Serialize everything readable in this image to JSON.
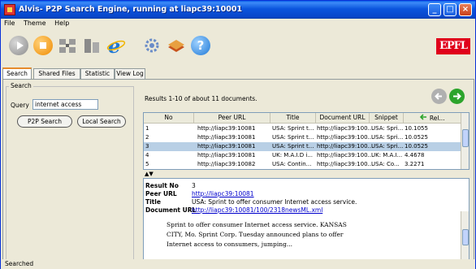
{
  "window": {
    "title": "Alvis- P2P Search Engine, running at liapc39:10001",
    "controls": {
      "minimize": "_",
      "maximize": "□",
      "close": "×"
    }
  },
  "menu": [
    "File",
    "Theme",
    "Help"
  ],
  "toolbar": {
    "icons": [
      "play-icon",
      "stop-icon",
      "network-icon",
      "server-icon",
      "browser-icon",
      "settings-icon",
      "books-icon",
      "help-icon"
    ],
    "help_glyph": "?",
    "logo_text": "EPFL"
  },
  "tabs": [
    "Search",
    "Shared Files",
    "Statistic",
    "View Log"
  ],
  "search": {
    "group_label": "Search",
    "query_label": "Query",
    "query_value": "internet access",
    "p2p_button": "P2P Search",
    "local_button": "Local Search"
  },
  "results": {
    "header": "Results  1-10 of about 11 documents.",
    "columns": [
      "No",
      "Peer URL",
      "Title",
      "Document URL",
      "Snippet",
      "Rel..."
    ],
    "selected_row": 3,
    "rows": [
      {
        "no": "1",
        "peer": "http://liapc39:10081",
        "title": "USA: Sprint t...",
        "doc": "http://liapc39:100...",
        "snippet": "USA: Spri...",
        "rel": "10.1055"
      },
      {
        "no": "2",
        "peer": "http://liapc39:10081",
        "title": "USA: Sprint t...",
        "doc": "http://liapc39:100...",
        "snippet": "USA: Spri...",
        "rel": "10.0525"
      },
      {
        "no": "3",
        "peer": "http://liapc39:10081",
        "title": "USA: Sprint t...",
        "doc": "http://liapc39:100...",
        "snippet": "USA: Spri...",
        "rel": "10.0525"
      },
      {
        "no": "4",
        "peer": "http://liapc39:10081",
        "title": "UK: M.A.I.D i...",
        "doc": "http://liapc39:100...",
        "snippet": "UK: M.A.I...",
        "rel": "4.4678"
      },
      {
        "no": "5",
        "peer": "http://liapc39:10082",
        "title": "USA: Contin...",
        "doc": "http://liapc39:100...",
        "snippet": "USA: Co...",
        "rel": "3.2271"
      }
    ]
  },
  "detail": {
    "labels": {
      "result_no": "Result No",
      "peer_url": "Peer URL",
      "title": "Title",
      "doc_url": "Document URL"
    },
    "result_no": "3",
    "peer_url": "http://liapc39:10081",
    "title": "USA: Sprint to offer consumer Internet access service.",
    "doc_url": "http://liapc39:10081/100/2318newsML.xml",
    "snippet_lines": [
      "Sprint to offer consumer Internet access service. KANSAS",
      "CITY, Mo. Sprint Corp. Tuesday announced plans to offer",
      "Internet access to consumers, jumping..."
    ]
  },
  "status": "Searched",
  "colors": {
    "titlebar": "#0b55dd",
    "selection": "#b8cfe5",
    "link": "#0000cc",
    "epfl_red": "#e0001b",
    "nav_back": "#b0b0b0",
    "nav_forward": "#2ca42c"
  }
}
